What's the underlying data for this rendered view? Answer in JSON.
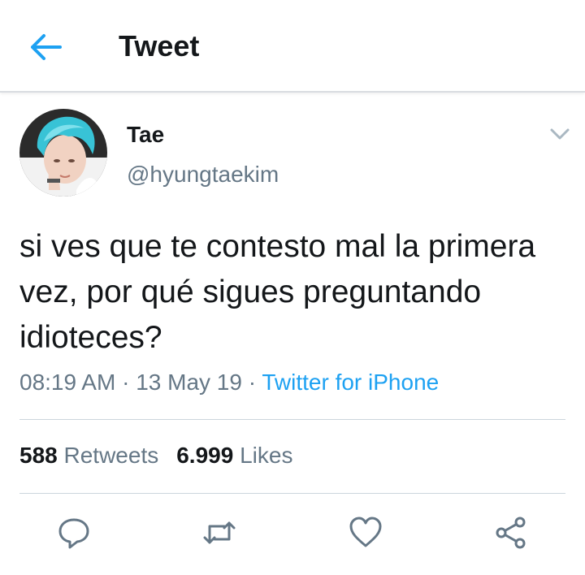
{
  "header": {
    "title": "Tweet",
    "back_icon": "arrow-left-icon",
    "accent": "#1da1f2"
  },
  "tweet": {
    "display_name": "Tae",
    "handle": "@hyungtaekim",
    "text": "si ves que te contesto mal la primera vez, por qué sigues preguntando idioteces?",
    "time": "08:19 AM",
    "date": "13 May 19",
    "separator": "·",
    "source": "Twitter for iPhone"
  },
  "stats": {
    "retweets_count": "588",
    "retweets_label": "Retweets",
    "likes_count": "6.999",
    "likes_label": "Likes"
  },
  "actions": [
    "reply-icon",
    "retweet-icon",
    "like-icon",
    "share-icon"
  ],
  "colors": {
    "text": "#14171a",
    "secondary": "#657786",
    "link": "#1da1f2",
    "divider": "#ccd6dd"
  }
}
